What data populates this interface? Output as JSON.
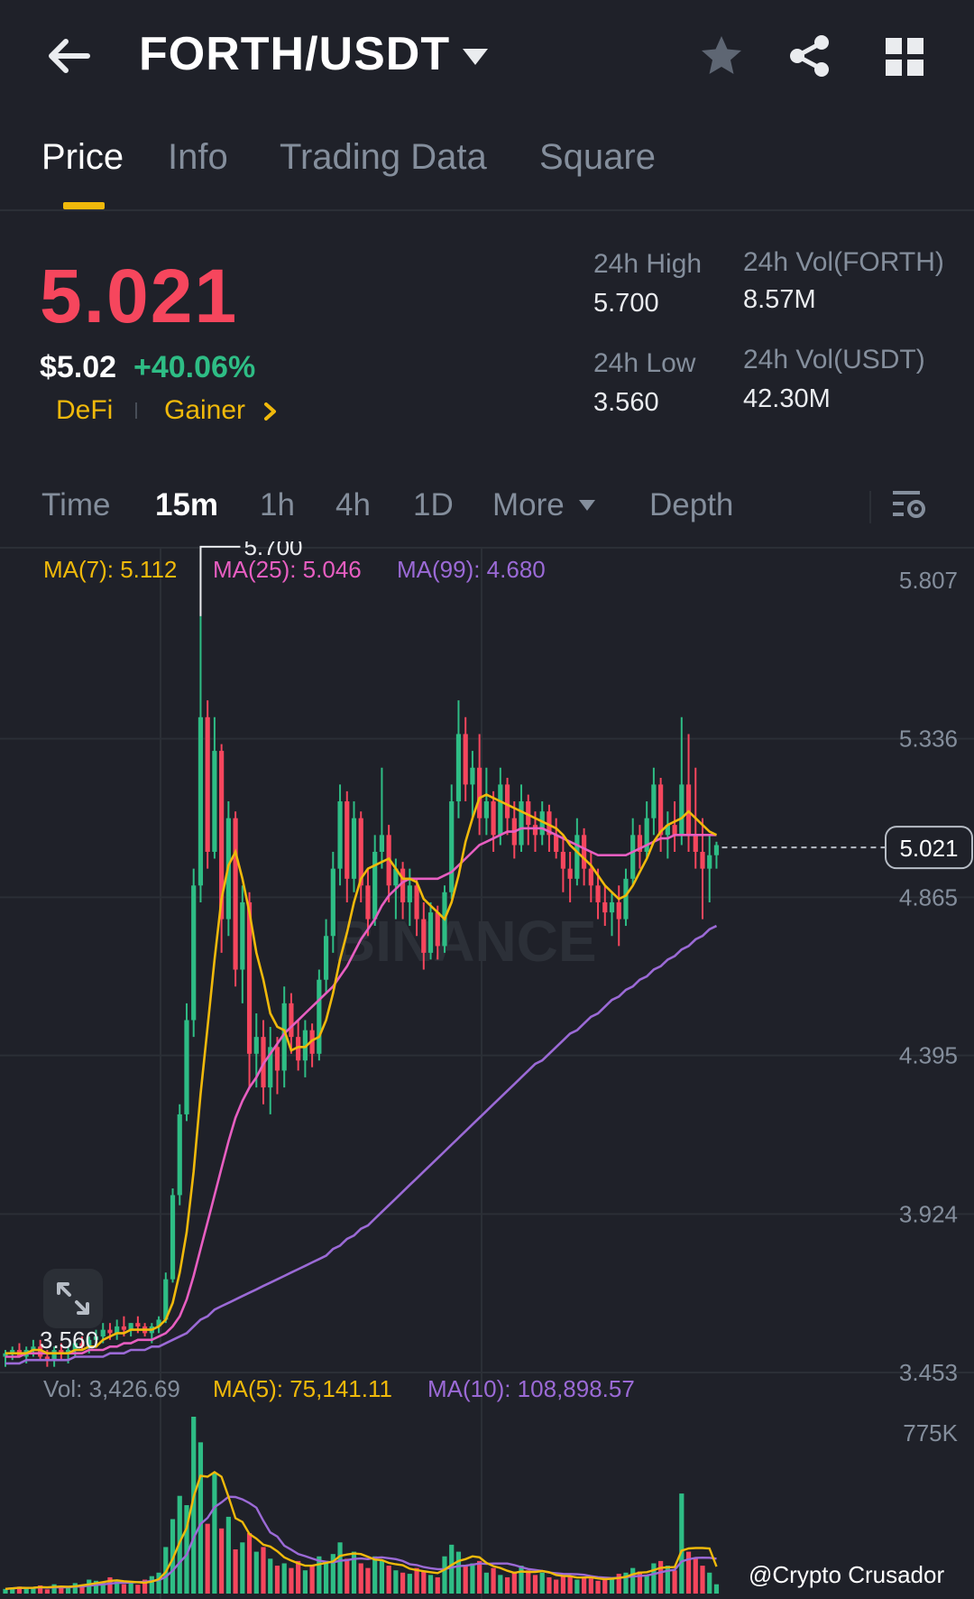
{
  "header": {
    "title": "FORTH/USDT",
    "back_icon": "arrow-left-icon",
    "icons": [
      "star-icon",
      "share-icon",
      "grid-icon"
    ]
  },
  "tabs": [
    {
      "label": "Price",
      "active": true
    },
    {
      "label": "Info",
      "active": false
    },
    {
      "label": "Trading Data",
      "active": false
    },
    {
      "label": "Square",
      "active": false
    }
  ],
  "price": {
    "last": "5.021",
    "usd": "$5.02",
    "change": "+40.06%",
    "tags": [
      "DeFi",
      "Gainer"
    ]
  },
  "stats": {
    "high_label": "24h High",
    "high_value": "5.700",
    "low_label": "24h Low",
    "low_value": "3.560",
    "vol_base_label": "24h Vol(FORTH)",
    "vol_base_value": "8.57M",
    "vol_quote_label": "24h Vol(USDT)",
    "vol_quote_value": "42.30M"
  },
  "timeframes": {
    "items": [
      {
        "label": "Time",
        "active": false
      },
      {
        "label": "15m",
        "active": true
      },
      {
        "label": "1h",
        "active": false
      },
      {
        "label": "4h",
        "active": false
      },
      {
        "label": "1D",
        "active": false
      },
      {
        "label": "More",
        "active": false
      },
      {
        "label": "Depth",
        "active": false
      }
    ]
  },
  "ma_legend": {
    "ma7": "MA(7): 5.112",
    "ma25": "MA(25): 5.046",
    "ma99": "MA(99): 4.680"
  },
  "vol_legend": {
    "vol": "Vol: 3,426.69",
    "ma5": "MA(5): 75,141.11",
    "ma10": "MA(10): 108,898.57"
  },
  "colors": {
    "up": "#2ebd85",
    "down": "#f6465d",
    "ma7": "#f0b90b",
    "ma25": "#e75ec1",
    "ma99": "#9b6ad6",
    "accent": "#f0b90b"
  },
  "watermark": {
    "brand": "BINANCE",
    "credit": "@Crypto Crusador"
  },
  "chart_data": {
    "type": "candlestick",
    "price_axis_ticks": [
      "5.807",
      "5.336",
      "4.865",
      "4.395",
      "3.924",
      "3.453"
    ],
    "volume_axis_ticks": [
      "775K"
    ],
    "current_price_label": "5.021",
    "high_marker": "5.700",
    "low_marker": "3.560",
    "candles": [
      [
        3.5,
        3.52,
        3.47,
        3.51
      ],
      [
        3.51,
        3.53,
        3.49,
        3.52
      ],
      [
        3.52,
        3.54,
        3.5,
        3.5
      ],
      [
        3.5,
        3.53,
        3.48,
        3.52
      ],
      [
        3.52,
        3.55,
        3.5,
        3.53
      ],
      [
        3.53,
        3.55,
        3.49,
        3.5
      ],
      [
        3.5,
        3.52,
        3.47,
        3.49
      ],
      [
        3.49,
        3.53,
        3.47,
        3.52
      ],
      [
        3.52,
        3.54,
        3.49,
        3.51
      ],
      [
        3.51,
        3.53,
        3.48,
        3.52
      ],
      [
        3.52,
        3.55,
        3.5,
        3.54
      ],
      [
        3.54,
        3.56,
        3.52,
        3.53
      ],
      [
        3.53,
        3.56,
        3.51,
        3.55
      ],
      [
        3.55,
        3.58,
        3.53,
        3.56
      ],
      [
        3.56,
        3.6,
        3.54,
        3.58
      ],
      [
        3.58,
        3.6,
        3.55,
        3.57
      ],
      [
        3.57,
        3.61,
        3.55,
        3.59
      ],
      [
        3.59,
        3.62,
        3.56,
        3.58
      ],
      [
        3.58,
        3.6,
        3.56,
        3.6
      ],
      [
        3.6,
        3.62,
        3.57,
        3.59
      ],
      [
        3.59,
        3.6,
        3.56,
        3.57
      ],
      [
        3.57,
        3.6,
        3.54,
        3.59
      ],
      [
        3.59,
        3.62,
        3.57,
        3.61
      ],
      [
        3.61,
        3.75,
        3.6,
        3.73
      ],
      [
        3.73,
        4.0,
        3.72,
        3.98
      ],
      [
        3.98,
        4.25,
        3.95,
        4.22
      ],
      [
        4.22,
        4.55,
        4.2,
        4.5
      ],
      [
        4.5,
        4.95,
        4.45,
        4.9
      ],
      [
        4.9,
        5.7,
        4.85,
        5.4
      ],
      [
        5.4,
        5.45,
        4.95,
        5.0
      ],
      [
        5.0,
        5.4,
        4.98,
        5.3
      ],
      [
        5.3,
        5.32,
        4.7,
        4.8
      ],
      [
        4.8,
        5.15,
        4.75,
        5.1
      ],
      [
        5.1,
        5.12,
        4.6,
        4.65
      ],
      [
        4.65,
        4.9,
        4.55,
        4.85
      ],
      [
        4.85,
        4.88,
        4.3,
        4.4
      ],
      [
        4.4,
        4.52,
        4.3,
        4.45
      ],
      [
        4.45,
        4.5,
        4.25,
        4.3
      ],
      [
        4.3,
        4.48,
        4.22,
        4.42
      ],
      [
        4.42,
        4.45,
        4.28,
        4.35
      ],
      [
        4.35,
        4.6,
        4.3,
        4.55
      ],
      [
        4.55,
        4.58,
        4.4,
        4.45
      ],
      [
        4.45,
        4.5,
        4.35,
        4.38
      ],
      [
        4.38,
        4.5,
        4.33,
        4.47
      ],
      [
        4.47,
        4.49,
        4.36,
        4.4
      ],
      [
        4.4,
        4.65,
        4.38,
        4.62
      ],
      [
        4.62,
        4.8,
        4.58,
        4.75
      ],
      [
        4.75,
        5.0,
        4.7,
        4.95
      ],
      [
        4.95,
        5.2,
        4.9,
        5.15
      ],
      [
        5.15,
        5.18,
        4.85,
        4.92
      ],
      [
        4.92,
        5.15,
        4.88,
        5.1
      ],
      [
        5.1,
        5.12,
        4.85,
        4.9
      ],
      [
        4.9,
        4.95,
        4.75,
        4.8
      ],
      [
        4.8,
        5.05,
        4.78,
        5.0
      ],
      [
        5.0,
        5.25,
        4.95,
        5.05
      ],
      [
        5.05,
        5.08,
        4.85,
        4.9
      ],
      [
        4.9,
        4.98,
        4.8,
        4.95
      ],
      [
        4.95,
        4.97,
        4.8,
        4.85
      ],
      [
        4.85,
        4.95,
        4.78,
        4.9
      ],
      [
        4.9,
        4.92,
        4.75,
        4.8
      ],
      [
        4.8,
        4.85,
        4.65,
        4.7
      ],
      [
        4.7,
        4.85,
        4.68,
        4.82
      ],
      [
        4.82,
        4.84,
        4.68,
        4.72
      ],
      [
        4.72,
        4.9,
        4.7,
        4.88
      ],
      [
        4.88,
        5.2,
        4.86,
        5.15
      ],
      [
        5.15,
        5.45,
        5.1,
        5.35
      ],
      [
        5.35,
        5.4,
        5.15,
        5.2
      ],
      [
        5.2,
        5.3,
        5.1,
        5.25
      ],
      [
        5.25,
        5.35,
        5.05,
        5.1
      ],
      [
        5.1,
        5.25,
        5.05,
        5.15
      ],
      [
        5.15,
        5.18,
        5.0,
        5.05
      ],
      [
        5.05,
        5.25,
        5.02,
        5.2
      ],
      [
        5.2,
        5.22,
        5.05,
        5.1
      ],
      [
        5.1,
        5.15,
        4.98,
        5.02
      ],
      [
        5.02,
        5.2,
        5.0,
        5.15
      ],
      [
        5.15,
        5.17,
        5.02,
        5.08
      ],
      [
        5.08,
        5.12,
        5.0,
        5.05
      ],
      [
        5.05,
        5.15,
        5.02,
        5.12
      ],
      [
        5.12,
        5.14,
        5.0,
        5.05
      ],
      [
        5.05,
        5.1,
        4.98,
        5.0
      ],
      [
        5.0,
        5.05,
        4.88,
        4.95
      ],
      [
        4.95,
        5.0,
        4.85,
        4.92
      ],
      [
        4.92,
        5.1,
        4.9,
        5.05
      ],
      [
        5.05,
        5.07,
        4.9,
        4.95
      ],
      [
        4.95,
        5.0,
        4.85,
        4.9
      ],
      [
        4.9,
        4.95,
        4.8,
        4.85
      ],
      [
        4.85,
        4.9,
        4.78,
        4.82
      ],
      [
        4.82,
        4.88,
        4.75,
        4.85
      ],
      [
        4.85,
        4.9,
        4.72,
        4.8
      ],
      [
        4.8,
        4.95,
        4.78,
        4.92
      ],
      [
        4.92,
        5.1,
        4.9,
        5.05
      ],
      [
        5.05,
        5.08,
        4.95,
        5.0
      ],
      [
        5.0,
        5.15,
        4.98,
        5.1
      ],
      [
        5.1,
        5.25,
        5.05,
        5.2
      ],
      [
        5.2,
        5.22,
        5.0,
        5.05
      ],
      [
        5.05,
        5.12,
        4.98,
        5.08
      ],
      [
        5.08,
        5.15,
        5.0,
        5.05
      ],
      [
        5.05,
        5.4,
        5.02,
        5.2
      ],
      [
        5.2,
        5.35,
        5.0,
        5.05
      ],
      [
        5.05,
        5.25,
        4.95,
        5.0
      ],
      [
        5.0,
        5.1,
        4.8,
        4.95
      ],
      [
        4.95,
        5.05,
        4.85,
        4.99
      ],
      [
        4.99,
        5.03,
        4.95,
        5.02
      ]
    ],
    "ma7": [
      3.51,
      3.51,
      3.51,
      3.51,
      3.52,
      3.52,
      3.51,
      3.51,
      3.51,
      3.51,
      3.52,
      3.52,
      3.53,
      3.53,
      3.55,
      3.56,
      3.57,
      3.57,
      3.58,
      3.58,
      3.58,
      3.58,
      3.59,
      3.61,
      3.66,
      3.75,
      3.87,
      4.05,
      4.28,
      4.48,
      4.68,
      4.86,
      4.96,
      5.0,
      4.92,
      4.82,
      4.7,
      4.62,
      4.52,
      4.48,
      4.47,
      4.41,
      4.42,
      4.42,
      4.44,
      4.45,
      4.5,
      4.58,
      4.68,
      4.76,
      4.85,
      4.92,
      4.95,
      4.96,
      4.97,
      4.98,
      4.95,
      4.92,
      4.92,
      4.91,
      4.86,
      4.84,
      4.82,
      4.8,
      4.85,
      4.93,
      5.03,
      5.1,
      5.16,
      5.17,
      5.16,
      5.15,
      5.14,
      5.13,
      5.12,
      5.11,
      5.1,
      5.09,
      5.08,
      5.07,
      5.05,
      5.02,
      5.0,
      4.98,
      4.96,
      4.93,
      4.9,
      4.88,
      4.86,
      4.87,
      4.9,
      4.94,
      4.98,
      5.03,
      5.06,
      5.08,
      5.09,
      5.1,
      5.12,
      5.1,
      5.08,
      5.06,
      5.05
    ],
    "ma25": [
      3.5,
      3.5,
      3.5,
      3.51,
      3.51,
      3.51,
      3.51,
      3.51,
      3.51,
      3.51,
      3.51,
      3.51,
      3.52,
      3.52,
      3.52,
      3.53,
      3.53,
      3.54,
      3.54,
      3.55,
      3.55,
      3.55,
      3.56,
      3.57,
      3.59,
      3.62,
      3.67,
      3.74,
      3.82,
      3.9,
      3.98,
      4.06,
      4.14,
      4.21,
      4.26,
      4.3,
      4.33,
      4.37,
      4.4,
      4.43,
      4.46,
      4.48,
      4.5,
      4.52,
      4.54,
      4.56,
      4.58,
      4.6,
      4.63,
      4.66,
      4.7,
      4.74,
      4.77,
      4.8,
      4.84,
      4.87,
      4.89,
      4.91,
      4.92,
      4.92,
      4.92,
      4.92,
      4.92,
      4.93,
      4.94,
      4.96,
      4.98,
      5.0,
      5.02,
      5.03,
      5.04,
      5.05,
      5.06,
      5.06,
      5.07,
      5.07,
      5.07,
      5.07,
      5.06,
      5.05,
      5.04,
      5.03,
      5.02,
      5.01,
      5.0,
      4.99,
      4.99,
      4.99,
      4.99,
      4.99,
      5.0,
      5.01,
      5.02,
      5.03,
      5.04,
      5.04,
      5.05,
      5.05,
      5.05,
      5.05,
      5.05,
      5.05,
      5.05
    ],
    "ma99": [
      3.48,
      3.48,
      3.48,
      3.49,
      3.49,
      3.49,
      3.49,
      3.49,
      3.49,
      3.49,
      3.5,
      3.5,
      3.5,
      3.5,
      3.5,
      3.51,
      3.51,
      3.51,
      3.52,
      3.52,
      3.52,
      3.53,
      3.53,
      3.54,
      3.55,
      3.56,
      3.57,
      3.59,
      3.61,
      3.62,
      3.64,
      3.65,
      3.66,
      3.67,
      3.68,
      3.69,
      3.7,
      3.71,
      3.72,
      3.73,
      3.74,
      3.75,
      3.76,
      3.77,
      3.78,
      3.79,
      3.8,
      3.82,
      3.83,
      3.85,
      3.86,
      3.88,
      3.89,
      3.91,
      3.93,
      3.95,
      3.97,
      3.99,
      4.01,
      4.03,
      4.05,
      4.07,
      4.09,
      4.11,
      4.13,
      4.15,
      4.17,
      4.19,
      4.21,
      4.23,
      4.25,
      4.27,
      4.29,
      4.31,
      4.33,
      4.35,
      4.37,
      4.38,
      4.4,
      4.42,
      4.44,
      4.46,
      4.47,
      4.49,
      4.51,
      4.52,
      4.54,
      4.56,
      4.57,
      4.59,
      4.6,
      4.62,
      4.63,
      4.65,
      4.66,
      4.68,
      4.69,
      4.71,
      4.72,
      4.74,
      4.75,
      4.77,
      4.78
    ],
    "volumes": [
      20,
      25,
      30,
      22,
      28,
      35,
      18,
      40,
      30,
      25,
      45,
      38,
      60,
      55,
      48,
      70,
      52,
      40,
      45,
      38,
      60,
      75,
      90,
      200,
      320,
      420,
      380,
      760,
      650,
      300,
      520,
      280,
      330,
      190,
      220,
      260,
      180,
      200,
      150,
      120,
      130,
      110,
      140,
      100,
      120,
      160,
      140,
      170,
      220,
      150,
      180,
      130,
      110,
      160,
      140,
      120,
      100,
      90,
      85,
      110,
      95,
      80,
      70,
      160,
      210,
      180,
      120,
      130,
      140,
      90,
      110,
      80,
      70,
      95,
      120,
      100,
      80,
      90,
      70,
      60,
      80,
      75,
      60,
      70,
      65,
      55,
      60,
      70,
      85,
      90,
      110,
      95,
      80,
      130,
      140,
      120,
      100,
      430,
      180,
      150,
      120,
      90,
      40
    ]
  }
}
